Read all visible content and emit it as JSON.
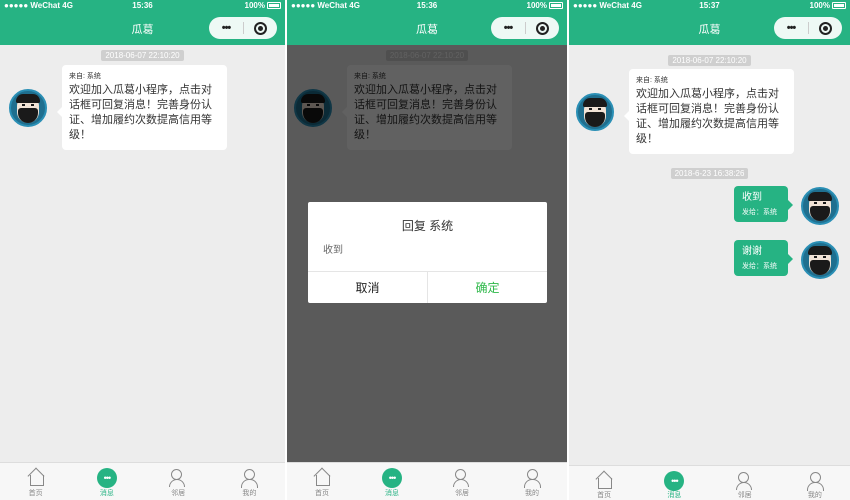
{
  "status": {
    "carrier": "●●●●● WeChat 4G",
    "battery": "100%",
    "time_screen1": "15:36",
    "time_screen2": "15:36",
    "time_screen3": "15:37"
  },
  "nav": {
    "title": "瓜葛",
    "more_glyph": "•••"
  },
  "chat": {
    "timestamp_1": "2018-06-07 22:10:20",
    "timestamp_2": "2018-6-23 16:38:26",
    "system_message": {
      "from": "来自: 系统",
      "text": "欢迎加入瓜葛小程序，点击对话框可回复消息！完善身份认证、增加履约次数提高信用等级！"
    },
    "replies": [
      {
        "text": "收到",
        "sender": "发给：系统"
      },
      {
        "text": "谢谢",
        "sender": "发给：系统"
      }
    ]
  },
  "dialog": {
    "title": "回复 系统",
    "content": "收到",
    "cancel_label": "取消",
    "confirm_label": "确定"
  },
  "tabbar": {
    "items": [
      {
        "label": "首页",
        "icon": "home-icon"
      },
      {
        "label": "消息",
        "icon": "message-icon"
      },
      {
        "label": "邻居",
        "icon": "neighbors-icon"
      },
      {
        "label": "我的",
        "icon": "profile-icon"
      }
    ],
    "active_index": 1
  },
  "colors": {
    "brand": "#26b383",
    "confirm": "#2fb84a",
    "background": "#ededed",
    "mask": "rgba(0,0,0,0.62)"
  }
}
